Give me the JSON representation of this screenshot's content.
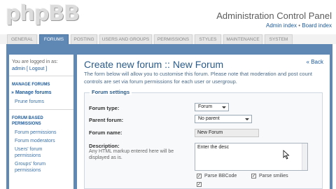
{
  "brand": {
    "logo_text": "phpBB"
  },
  "header": {
    "title": "Administration Control Panel",
    "admin_index": "Admin index",
    "separator": "•",
    "board_index": "Board index"
  },
  "tabs": [
    {
      "label": "GENERAL"
    },
    {
      "label": "FORUMS"
    },
    {
      "label": "POSTING"
    },
    {
      "label": "USERS AND GROUPS"
    },
    {
      "label": "PERMISSIONS"
    },
    {
      "label": "STYLES"
    },
    {
      "label": "MAINTENANCE"
    },
    {
      "label": "SYSTEM"
    }
  ],
  "active_tab": "FORUMS",
  "sidebar": {
    "logged_in_text": "You are logged in as:",
    "user": "admin",
    "logout": "[ Logout ]",
    "section1_title": "MANAGE FORUMS",
    "section1_items": [
      {
        "label": "» Manage forums"
      },
      {
        "label": "Prune forums"
      }
    ],
    "section2_title_line1": "FORUM BASED",
    "section2_title_line2": "PERMISSIONS",
    "section2_items": [
      {
        "label": "Forum permissions"
      },
      {
        "label": "Forum moderators"
      },
      {
        "label": "Users' forum"
      },
      {
        "label": "permissions"
      },
      {
        "label": "Groups' forum"
      },
      {
        "label": "permissions"
      }
    ]
  },
  "main": {
    "title": "Create new forum :: New Forum",
    "back": "« Back",
    "intro": "The form below will allow you to customise this forum. Please note that moderation and post count controls are set via forum permissions for each user or usergroup.",
    "legend": "Forum settings",
    "forum_type_label": "Forum type:",
    "forum_type_value": "Forum",
    "parent_label": "Parent forum:",
    "parent_value": "No parent",
    "name_label": "Forum name:",
    "name_value": "New Forum",
    "desc_label": "Description:",
    "desc_help": "Any HTML markup entered here will be displayed as is.",
    "desc_value": "Enter the desc",
    "parse_bbcode": "Parse BBCode",
    "parse_smilies": "Parse smilies"
  },
  "colors": {
    "accent": "#5f88b4",
    "link": "#1b5999"
  }
}
